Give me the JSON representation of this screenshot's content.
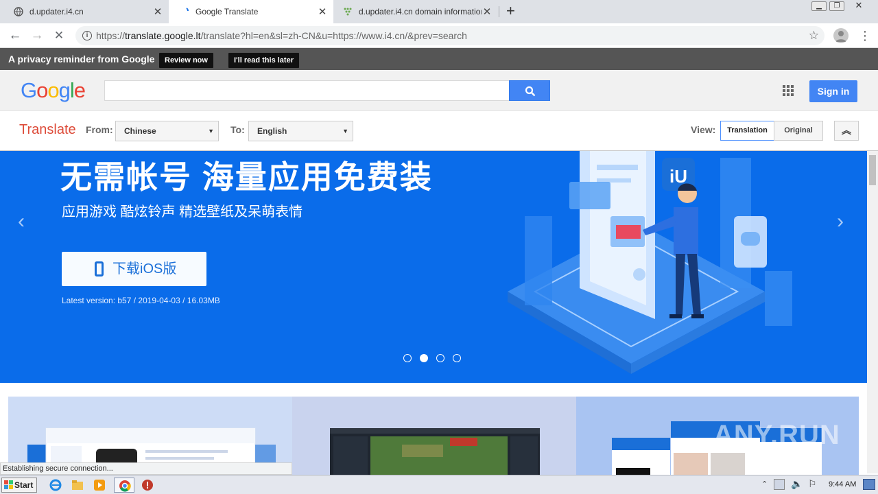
{
  "browser": {
    "tabs": [
      {
        "title": "d.updater.i4.cn"
      },
      {
        "title": "Google Translate"
      },
      {
        "title": "d.updater.i4.cn domain information -"
      }
    ],
    "new_tab": "+",
    "url_prefix": "https://",
    "url_host": "translate.google.lt",
    "url_rest": "/translate?hl=en&sl=zh-CN&u=https://www.i4.cn/&prev=search",
    "status_text": "Establishing secure connection..."
  },
  "privacy": {
    "text": "A privacy reminder from Google",
    "review_label": "Review now",
    "later_label": "I'll read this later"
  },
  "google": {
    "logo": [
      "G",
      "o",
      "o",
      "g",
      "l",
      "e"
    ],
    "logo_colors": [
      "#4285f4",
      "#ea4335",
      "#fbbc05",
      "#4285f4",
      "#34a853",
      "#ea4335"
    ],
    "signin_label": "Sign in"
  },
  "translate": {
    "title": "Translate",
    "from_label": "From:",
    "from_value": "Chinese",
    "to_label": "To:",
    "to_value": "English",
    "view_label": "View:",
    "translation_label": "Translation",
    "original_label": "Original"
  },
  "banner": {
    "headline": "无需帐号 海量应用免费装",
    "subline": "应用游戏  酷炫铃声  精选壁纸及呆萌表情",
    "download_label": "下载iOS版",
    "version": "Latest version: b57 / 2019-04-03 / 16.03MB",
    "slides": 4,
    "active_slide": 1,
    "colors": {
      "bg": "#0a6cea",
      "accent": "#1a6fd8"
    }
  },
  "taskbar": {
    "start_label": "Start",
    "clock": "9:44 AM"
  },
  "watermark": "ANY.RUN"
}
